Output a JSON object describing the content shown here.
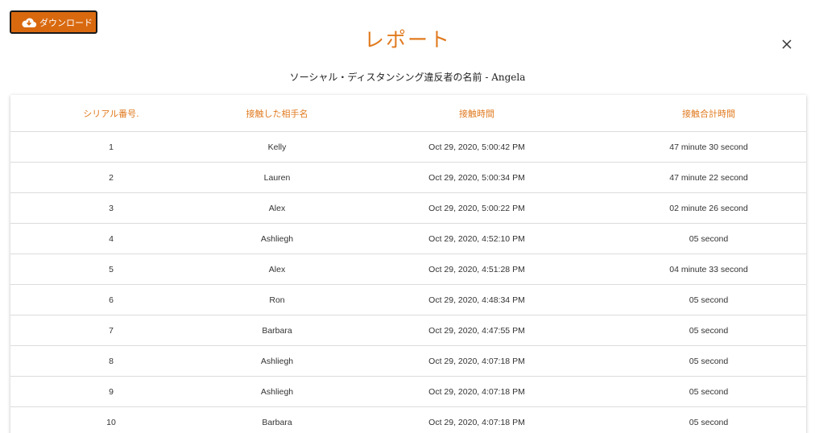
{
  "toolbar": {
    "download_label": "ダウンロード"
  },
  "dialog": {
    "title": "レポート",
    "subtitle": "ソーシャル・ディスタンシング違反者の名前 - Angela"
  },
  "colors": {
    "accent": "#e07a1f",
    "button_bg": "#d9690f"
  },
  "table": {
    "headers": [
      "シリアル番号.",
      "接触した相手名",
      "接触時間",
      "接触合計時間"
    ],
    "rows": [
      [
        "1",
        "Kelly",
        "Oct 29, 2020, 5:00:42 PM",
        "47 minute 30 second"
      ],
      [
        "2",
        "Lauren",
        "Oct 29, 2020, 5:00:34 PM",
        "47 minute 22 second"
      ],
      [
        "3",
        "Alex",
        "Oct 29, 2020, 5:00:22 PM",
        "02 minute 26 second"
      ],
      [
        "4",
        "Ashliegh",
        "Oct 29, 2020, 4:52:10 PM",
        "05 second"
      ],
      [
        "5",
        "Alex",
        "Oct 29, 2020, 4:51:28 PM",
        "04 minute 33 second"
      ],
      [
        "6",
        "Ron",
        "Oct 29, 2020, 4:48:34 PM",
        "05 second"
      ],
      [
        "7",
        "Barbara",
        "Oct 29, 2020, 4:47:55 PM",
        "05 second"
      ],
      [
        "8",
        "Ashliegh",
        "Oct 29, 2020, 4:07:18 PM",
        "05 second"
      ],
      [
        "9",
        "Ashliegh",
        "Oct 29, 2020, 4:07:18 PM",
        "05 second"
      ],
      [
        "10",
        "Barbara",
        "Oct 29, 2020, 4:07:18 PM",
        "05 second"
      ]
    ]
  }
}
